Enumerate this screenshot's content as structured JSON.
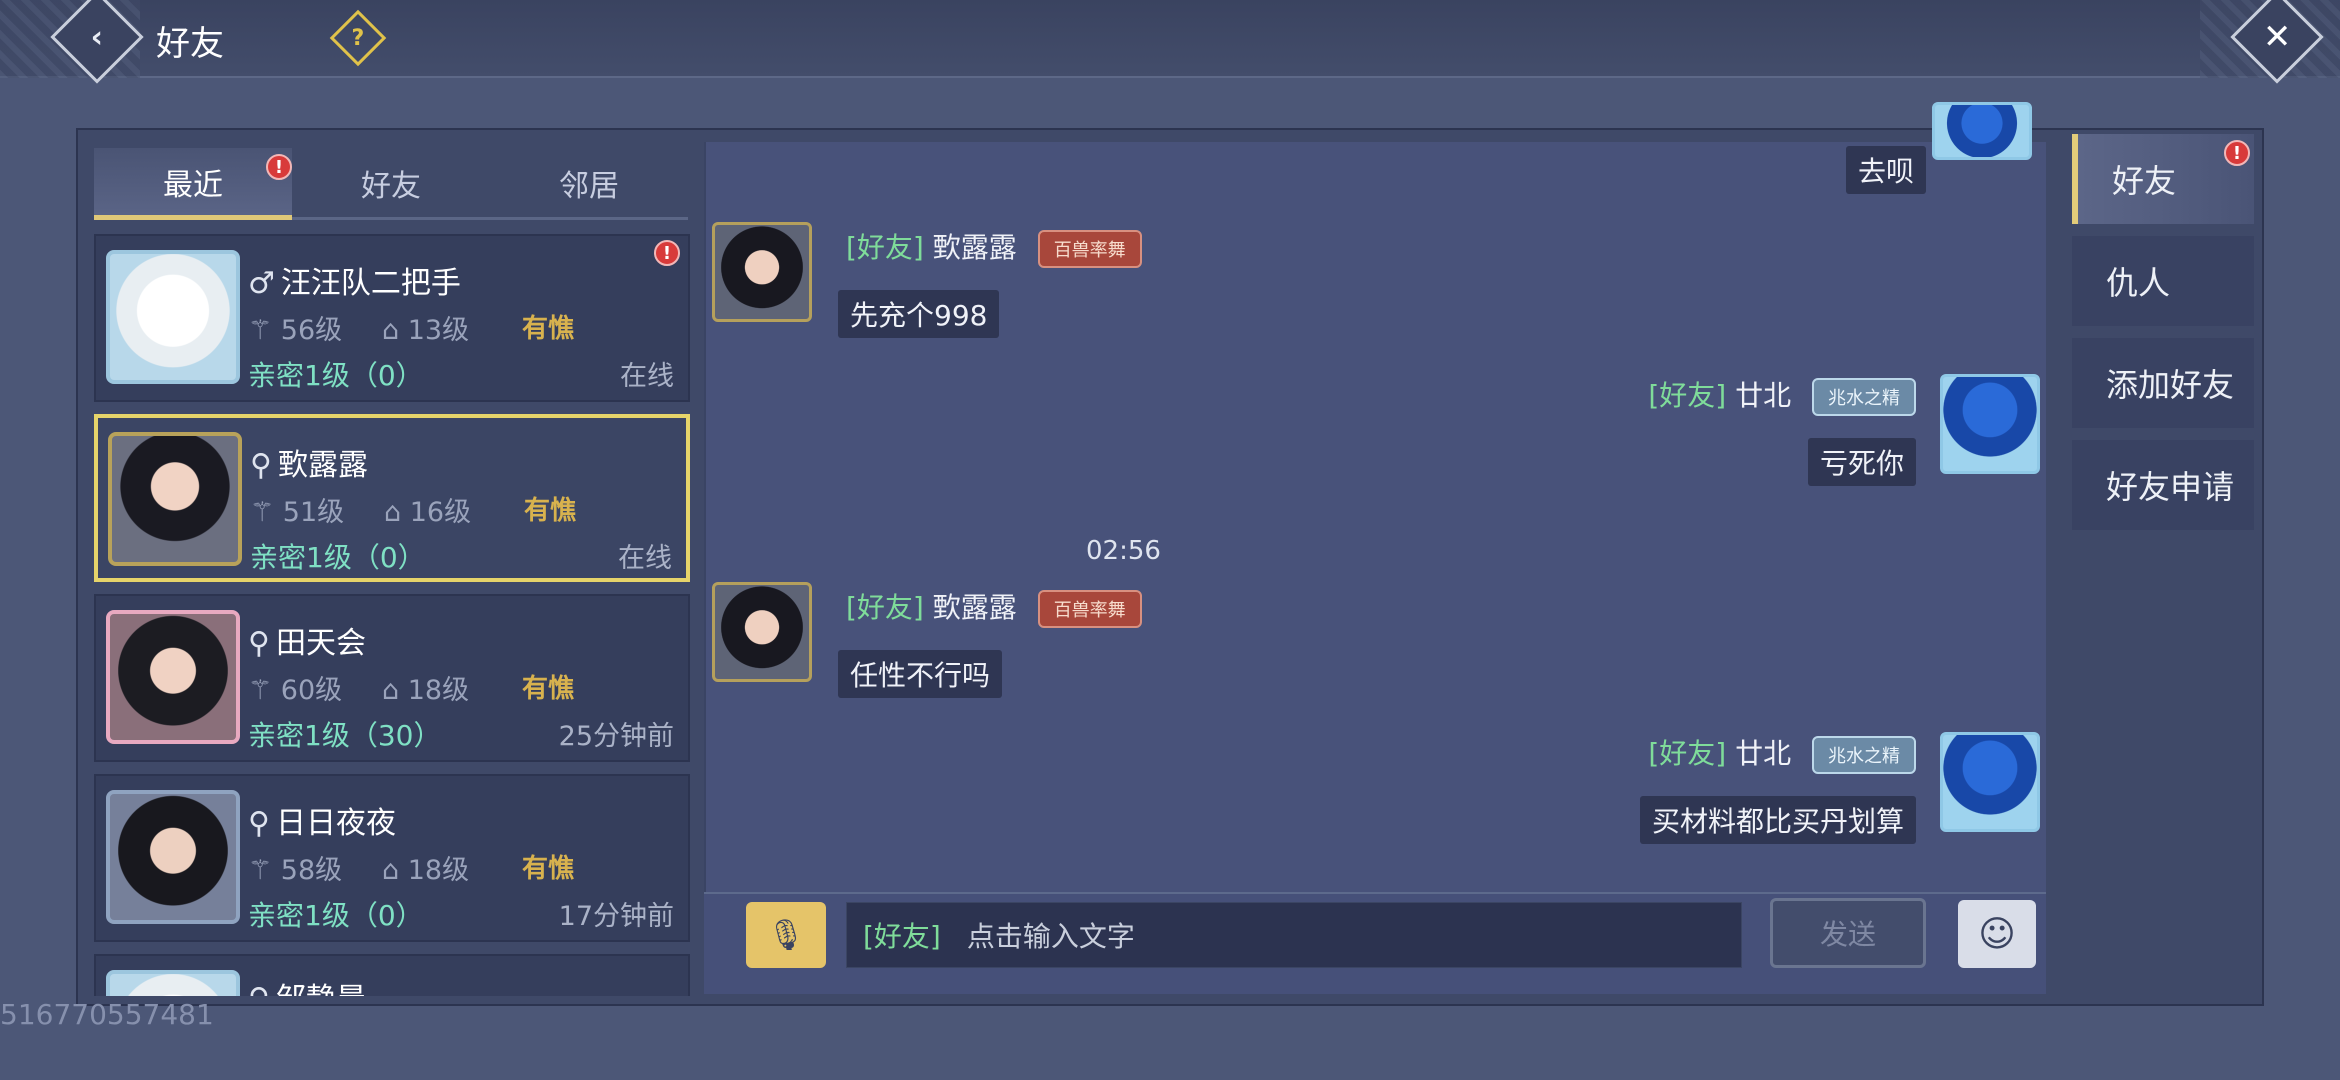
{
  "header": {
    "title": "好友",
    "back_icon": "‹",
    "help_icon": "?",
    "close_icon": "✕"
  },
  "tabs": [
    {
      "label": "最近",
      "badge": "!"
    },
    {
      "label": "好友"
    },
    {
      "label": "邻居"
    }
  ],
  "friends": [
    {
      "name": "汪汪队二把手",
      "gender_icon": "♂",
      "level": "56级",
      "house_level": "13级",
      "mood": "有憔",
      "intimacy": "亲密1级（0）",
      "status": "在线",
      "badge": "!"
    },
    {
      "name": "歅露露",
      "gender_icon": "⚲",
      "level": "51级",
      "house_level": "16级",
      "mood": "有憔",
      "intimacy": "亲密1级（0）",
      "status": "在线"
    },
    {
      "name": "田天会",
      "gender_icon": "⚲",
      "level": "60级",
      "house_level": "18级",
      "mood": "有憔",
      "intimacy": "亲密1级（30）",
      "status": "25分钟前"
    },
    {
      "name": "日日夜夜",
      "gender_icon": "⚲",
      "level": "58级",
      "house_level": "18级",
      "mood": "有憔",
      "intimacy": "亲密1级（0）",
      "status": "17分钟前"
    },
    {
      "name": "邹静晨",
      "gender_icon": "⚲"
    }
  ],
  "chat": {
    "messages": [
      {
        "side": "right",
        "text": "去呗"
      },
      {
        "side": "left",
        "tag": "[好友]",
        "sender": "歅露露",
        "title_badge": "百兽率舞",
        "text": "先充个998"
      },
      {
        "side": "right",
        "tag": "[好友]",
        "sender": "廿北",
        "title_badge": "兆水之精",
        "text": "亏死你"
      },
      {
        "side": "left",
        "tag": "[好友]",
        "sender": "歅露露",
        "title_badge": "百兽率舞",
        "text": "任性不行吗"
      },
      {
        "side": "right",
        "tag": "[好友]",
        "sender": "廿北",
        "title_badge": "兆水之精",
        "text": "买材料都比买丹划算"
      }
    ],
    "timestamp": "02:56",
    "input_prefix": "[好友]",
    "input_placeholder": "点击输入文字",
    "send_label": "发送",
    "voice_icon": "🎙",
    "emoji_icon": "☺"
  },
  "side_tabs": [
    {
      "label": "好友",
      "badge": "!"
    },
    {
      "label": "仇人"
    },
    {
      "label": "添加好友"
    },
    {
      "label": "好友申请"
    }
  ],
  "watermark": "516770557481"
}
